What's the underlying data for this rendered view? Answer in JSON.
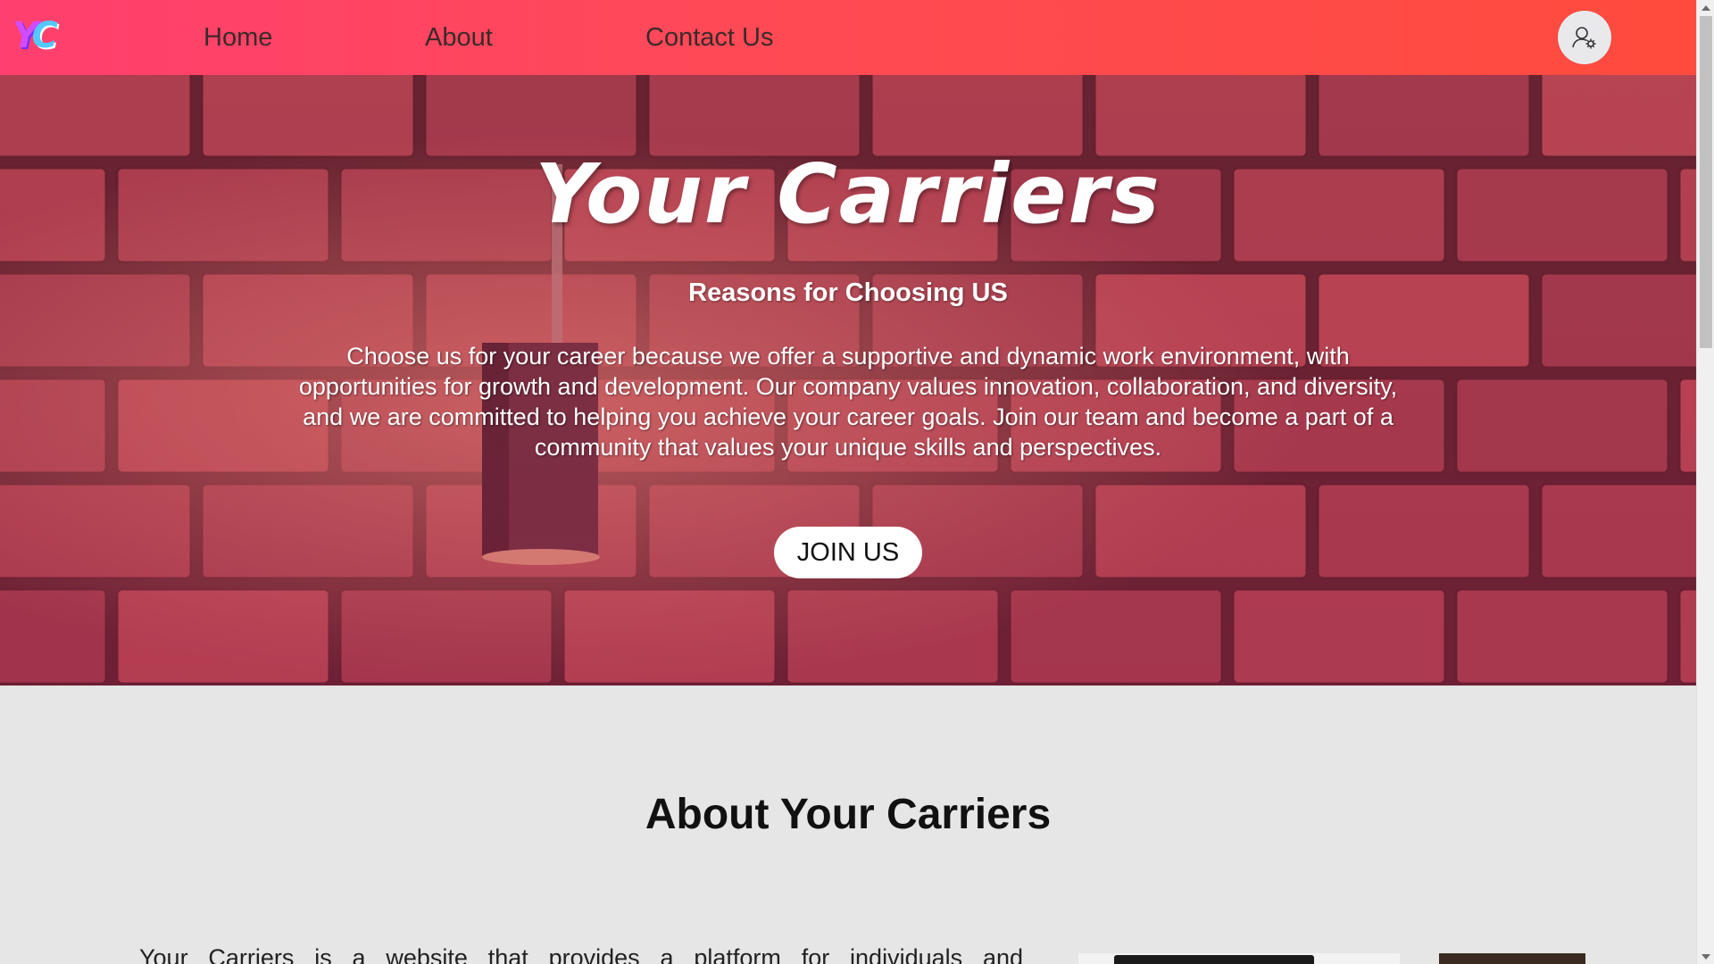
{
  "nav": {
    "logo_text": "YC",
    "links": [
      {
        "label": "Home"
      },
      {
        "label": "About"
      },
      {
        "label": "Contact Us"
      }
    ],
    "profile_icon": "user-settings-icon"
  },
  "hero": {
    "title": "Your Carriers",
    "subtitle": "Reasons for Choosing US",
    "description": "Choose us for your career because we offer a supportive and dynamic work environment, with opportunities for growth and development. Our company values innovation, collaboration, and diversity, and we are committed to helping you achieve your career goals. Join our team and become a part of a community that values your unique skills and perspectives.",
    "cta_label": "JOIN US",
    "background": "brick-wall-with-wall-lamp"
  },
  "about": {
    "title": "About Your Carriers",
    "text": "Your Carriers is a website that provides a platform for individuals and"
  },
  "colors": {
    "nav_gradient_start": "#ff3f6f",
    "nav_gradient_end": "#ff4b3d",
    "page_background": "#e6e6e6",
    "hero_tint": "#b43250"
  }
}
